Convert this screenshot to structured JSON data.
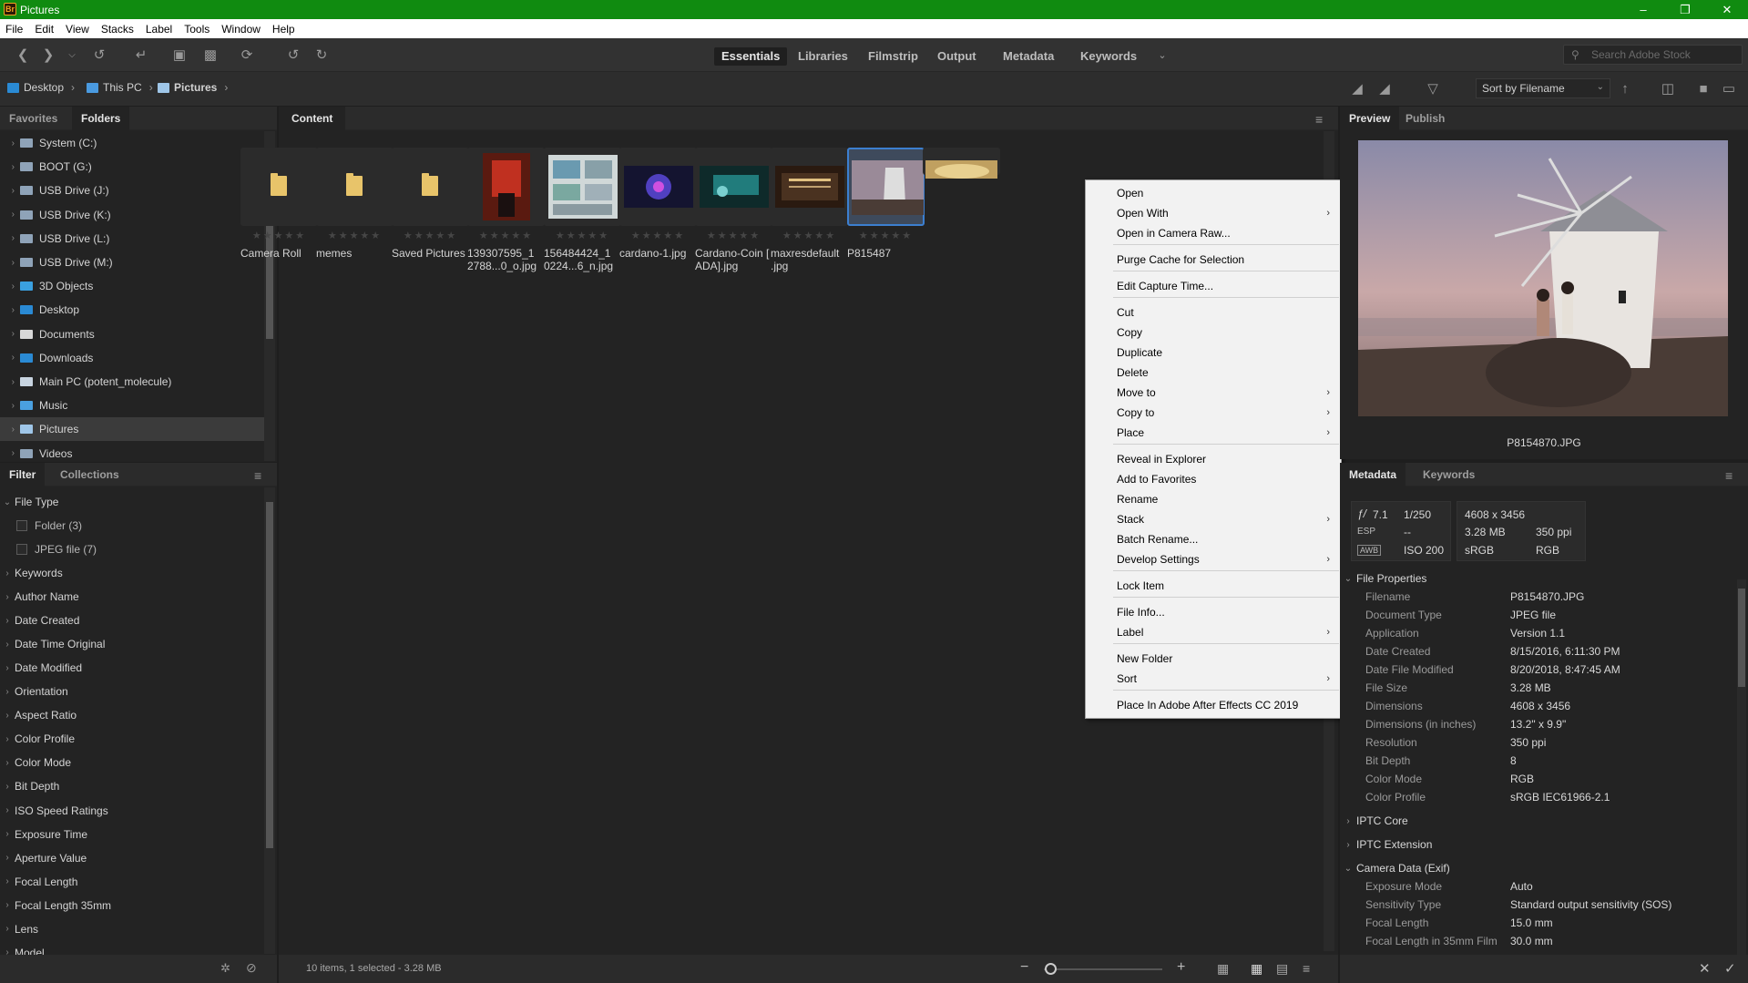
{
  "window": {
    "title": "Pictures",
    "app_icon": "Br"
  },
  "menubar": [
    "File",
    "Edit",
    "View",
    "Stacks",
    "Label",
    "Tools",
    "Window",
    "Help"
  ],
  "workspaces": [
    "Essentials",
    "Libraries",
    "Filmstrip",
    "Output",
    "Metadata",
    "Keywords"
  ],
  "search": {
    "placeholder": "Search Adobe Stock"
  },
  "breadcrumb": [
    "Desktop",
    "This PC",
    "Pictures"
  ],
  "sort": {
    "label": "Sort by Filename"
  },
  "left_tabs": {
    "favorites": "Favorites",
    "folders": "Folders"
  },
  "folders": [
    "System (C:)",
    "BOOT (G:)",
    "USB Drive (J:)",
    "USB Drive (K:)",
    "USB Drive (L:)",
    "USB Drive (M:)",
    "3D Objects",
    "Desktop",
    "Documents",
    "Downloads",
    "Main PC (potent_molecule)",
    "Music",
    "Pictures",
    "Videos"
  ],
  "filter_tabs": {
    "filter": "Filter",
    "collections": "Collections"
  },
  "filter": {
    "file_type": "File Type",
    "options": [
      "Folder (3)",
      "JPEG file (7)"
    ],
    "criteria": [
      "Keywords",
      "Author Name",
      "Date Created",
      "Date Time Original",
      "Date Modified",
      "Orientation",
      "Aspect Ratio",
      "Color Profile",
      "Color Mode",
      "Bit Depth",
      "ISO Speed Ratings",
      "Exposure Time",
      "Aperture Value",
      "Focal Length",
      "Focal Length 35mm",
      "Lens",
      "Model"
    ]
  },
  "content": {
    "tab": "Content",
    "items": [
      {
        "name": "Camera Roll"
      },
      {
        "name": "memes"
      },
      {
        "name": "Saved Pictures"
      },
      {
        "name": "139307595_1\n2788...0_o.jpg"
      },
      {
        "name": "156484424_1\n0224...6_n.jpg"
      },
      {
        "name": "cardano-1.jpg"
      },
      {
        "name": "Cardano-Coin [\nADA].jpg"
      },
      {
        "name": "maxresdefault\n.jpg"
      },
      {
        "name": "P815487"
      },
      {
        "name": ""
      }
    ],
    "stars": "★★★★★",
    "status": "10 items, 1 selected - 3.28 MB"
  },
  "context_menu": {
    "items": [
      "Open",
      "Open With",
      "Open in Camera Raw...",
      "Purge Cache for Selection",
      "Edit Capture Time...",
      "Cut",
      "Copy",
      "Duplicate",
      "Delete",
      "Move to",
      "Copy to",
      "Place",
      "Reveal in Explorer",
      "Add to Favorites",
      "Rename",
      "Stack",
      "Batch Rename...",
      "Develop Settings",
      "Lock Item",
      "File Info...",
      "Label",
      "New Folder",
      "Sort",
      "Place In Adobe After Effects CC 2019"
    ]
  },
  "preview": {
    "tabs": [
      "Preview",
      "Publish"
    ],
    "filename": "P8154870.JPG"
  },
  "metadata": {
    "tabs": [
      "Metadata",
      "Keywords"
    ],
    "summary": {
      "aperture": "7.1",
      "shutter": "1/250",
      "esp_label": "ESP",
      "esp_val": "--",
      "awb": "AWB",
      "iso": "ISO 200",
      "dims": "4608 x 3456",
      "size": "3.28 MB",
      "ppi": "350 ppi",
      "profile": "sRGB",
      "mode": "RGB"
    },
    "file_properties_title": "File Properties",
    "file_properties": [
      {
        "k": "Filename",
        "v": "P8154870.JPG"
      },
      {
        "k": "Document Type",
        "v": "JPEG file"
      },
      {
        "k": "Application",
        "v": "Version 1.1"
      },
      {
        "k": "Date Created",
        "v": "8/15/2016, 6:11:30 PM"
      },
      {
        "k": "Date File Modified",
        "v": "8/20/2018, 8:47:45 AM"
      },
      {
        "k": "File Size",
        "v": "3.28 MB"
      },
      {
        "k": "Dimensions",
        "v": "4608 x 3456"
      },
      {
        "k": "Dimensions (in inches)",
        "v": "13.2\" x 9.9\""
      },
      {
        "k": "Resolution",
        "v": "350 ppi"
      },
      {
        "k": "Bit Depth",
        "v": "8"
      },
      {
        "k": "Color Mode",
        "v": "RGB"
      },
      {
        "k": "Color Profile",
        "v": "sRGB IEC61966-2.1"
      }
    ],
    "sections": [
      "IPTC Core",
      "IPTC Extension",
      "Camera Data (Exif)"
    ],
    "exif": [
      {
        "k": "Exposure Mode",
        "v": "Auto"
      },
      {
        "k": "Sensitivity Type",
        "v": "Standard output sensitivity (SOS)"
      },
      {
        "k": "Focal Length",
        "v": "15.0 mm"
      },
      {
        "k": "Focal Length in 35mm Film",
        "v": "30.0 mm"
      }
    ]
  },
  "colors": {
    "titlebar": "#108b10",
    "accent": "#3c7fd0",
    "folder": "#e8c46a"
  }
}
